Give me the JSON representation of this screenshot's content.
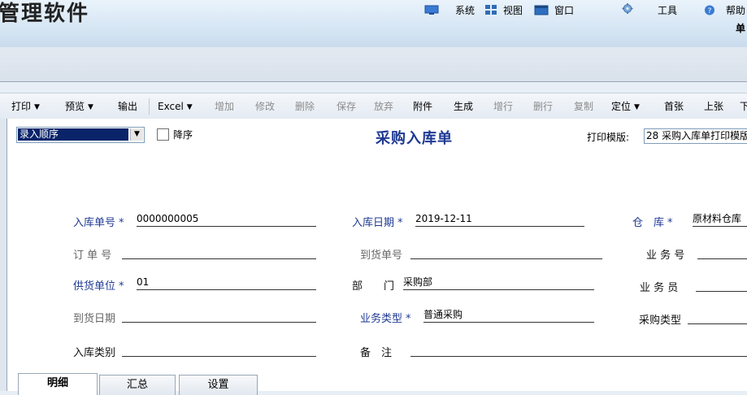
{
  "app": {
    "title": "管理软件",
    "unit_label": "单"
  },
  "top_menu": [
    {
      "label": "系统",
      "icon": "monitor-icon"
    },
    {
      "label": "视图",
      "icon": "grid-icon"
    },
    {
      "label": "窗口",
      "icon": "window-icon"
    },
    {
      "label": "工具",
      "icon": "gear-icon"
    },
    {
      "label": "帮助",
      "icon": "help-icon"
    }
  ],
  "toolbar": {
    "print": "打印",
    "preview": "预览",
    "export": "输出",
    "excel": "Excel",
    "add": "增加",
    "edit": "修改",
    "delete": "删除",
    "save": "保存",
    "discard": "放弃",
    "attachment": "附件",
    "generate": "生成",
    "add_row": "增行",
    "delete_row": "删行",
    "copy": "复制",
    "locate": "定位",
    "first": "首张",
    "prev": "上张",
    "next": "下"
  },
  "form": {
    "sort_select_value": "录入顺序",
    "desc_label": "降序",
    "title": "采购入库单",
    "print_template_label": "打印模版:",
    "print_template_value": "28 采购入库单打印模版",
    "fields": {
      "receipt_no": {
        "label": "入库单号",
        "value": "0000000005"
      },
      "receipt_date": {
        "label": "入库日期",
        "value": "2019-12-11"
      },
      "warehouse": {
        "label": "仓　库",
        "value": "原材料仓库"
      },
      "order_no": {
        "label": "订 单 号",
        "value": ""
      },
      "arrival_no": {
        "label": "到货单号",
        "value": ""
      },
      "business_no": {
        "label": "业 务 号",
        "value": ""
      },
      "supplier": {
        "label": "供货单位",
        "value": "01"
      },
      "department": {
        "label": "部　　门",
        "value": "采购部"
      },
      "salesperson": {
        "label": "业 务 员",
        "value": ""
      },
      "arrival_date": {
        "label": "到货日期",
        "value": ""
      },
      "business_type": {
        "label": "业务类型",
        "value": "普通采购"
      },
      "purchase_type": {
        "label": "采购类型",
        "value": ""
      },
      "receipt_category": {
        "label": "入库类别",
        "value": ""
      },
      "remarks": {
        "label": "备　注",
        "value": ""
      }
    }
  },
  "tabs": [
    {
      "label": "明细",
      "active": true
    },
    {
      "label": "汇总",
      "active": false
    },
    {
      "label": "设置",
      "active": false
    }
  ],
  "colors": {
    "accent_blue": "#1f3a93",
    "selection": "#0a246a",
    "disabled_text": "#8c8c8c"
  }
}
